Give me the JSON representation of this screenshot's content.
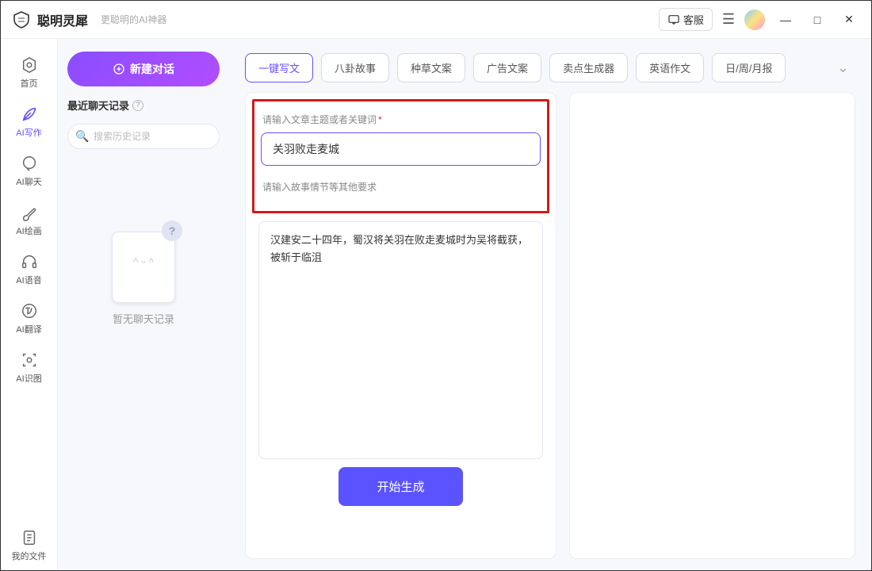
{
  "titlebar": {
    "app_name": "聪明灵犀",
    "subtitle": "更聪明的AI神器",
    "support_label": "客服"
  },
  "nav": {
    "items": [
      {
        "label": "首页"
      },
      {
        "label": "AI写作"
      },
      {
        "label": "AI聊天"
      },
      {
        "label": "AI绘画"
      },
      {
        "label": "AI语音"
      },
      {
        "label": "AI翻译"
      },
      {
        "label": "AI识图"
      }
    ],
    "files_label": "我的文件"
  },
  "chat_pane": {
    "new_chat_label": "新建对话",
    "recent_heading": "最近聊天记录",
    "search_placeholder": "搜索历史记录",
    "empty_text": "暂无聊天记录"
  },
  "tabs": {
    "items": [
      "一键写文",
      "八卦故事",
      "种草文案",
      "广告文案",
      "卖点生成器",
      "英语作文",
      "日/周/月报"
    ],
    "active_index": 0
  },
  "form": {
    "topic_label": "请输入文章主题或者关键词",
    "topic_value": "关羽败走麦城",
    "detail_label": "请输入故事情节等其他要求",
    "detail_value": "汉建安二十四年，蜀汉将关羽在败走麦城时为吴将截获，被斩于临沮",
    "generate_label": "开始生成"
  }
}
